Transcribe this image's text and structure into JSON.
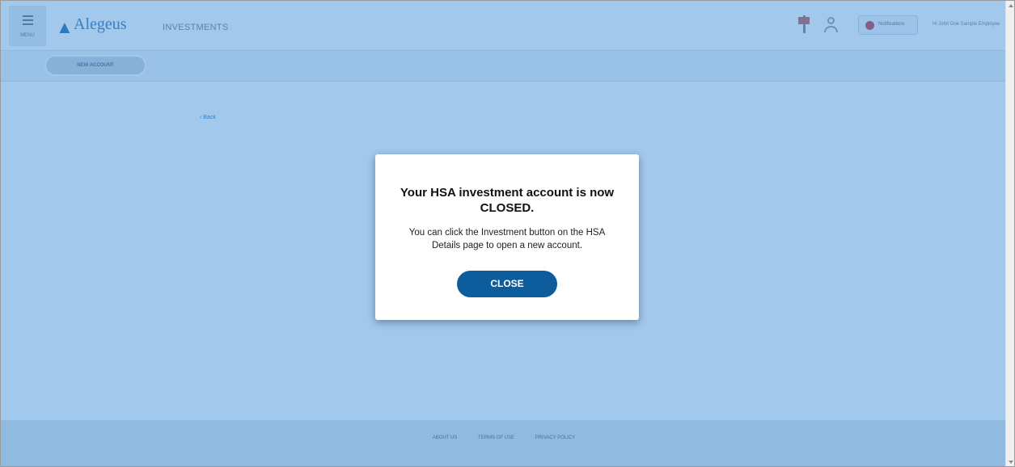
{
  "header": {
    "menu_label": "MENU",
    "logo_text": "Alegeus",
    "logo_sub": "",
    "section_title": "INVESTMENTS",
    "notifications_label": "Notifications",
    "user_name": "Hi John Doe Sample Employee"
  },
  "subbar": {
    "new_account_label": "NEW ACCOUNT"
  },
  "page": {
    "back_label": "Back",
    "heading": "",
    "paragraph": ""
  },
  "modal": {
    "title": "Your HSA investment account is now CLOSED.",
    "body": "You can click the Investment button on the HSA Details page to open a new account.",
    "close_label": "CLOSE"
  },
  "footer": {
    "links": [
      "ABOUT US",
      "TERMS OF USE",
      "PRIVACY POLICY"
    ],
    "copyright": ""
  },
  "colors": {
    "overlay": "#4691d7",
    "accent_button": "#0d5c9c",
    "modal_background": "#ffffff"
  }
}
